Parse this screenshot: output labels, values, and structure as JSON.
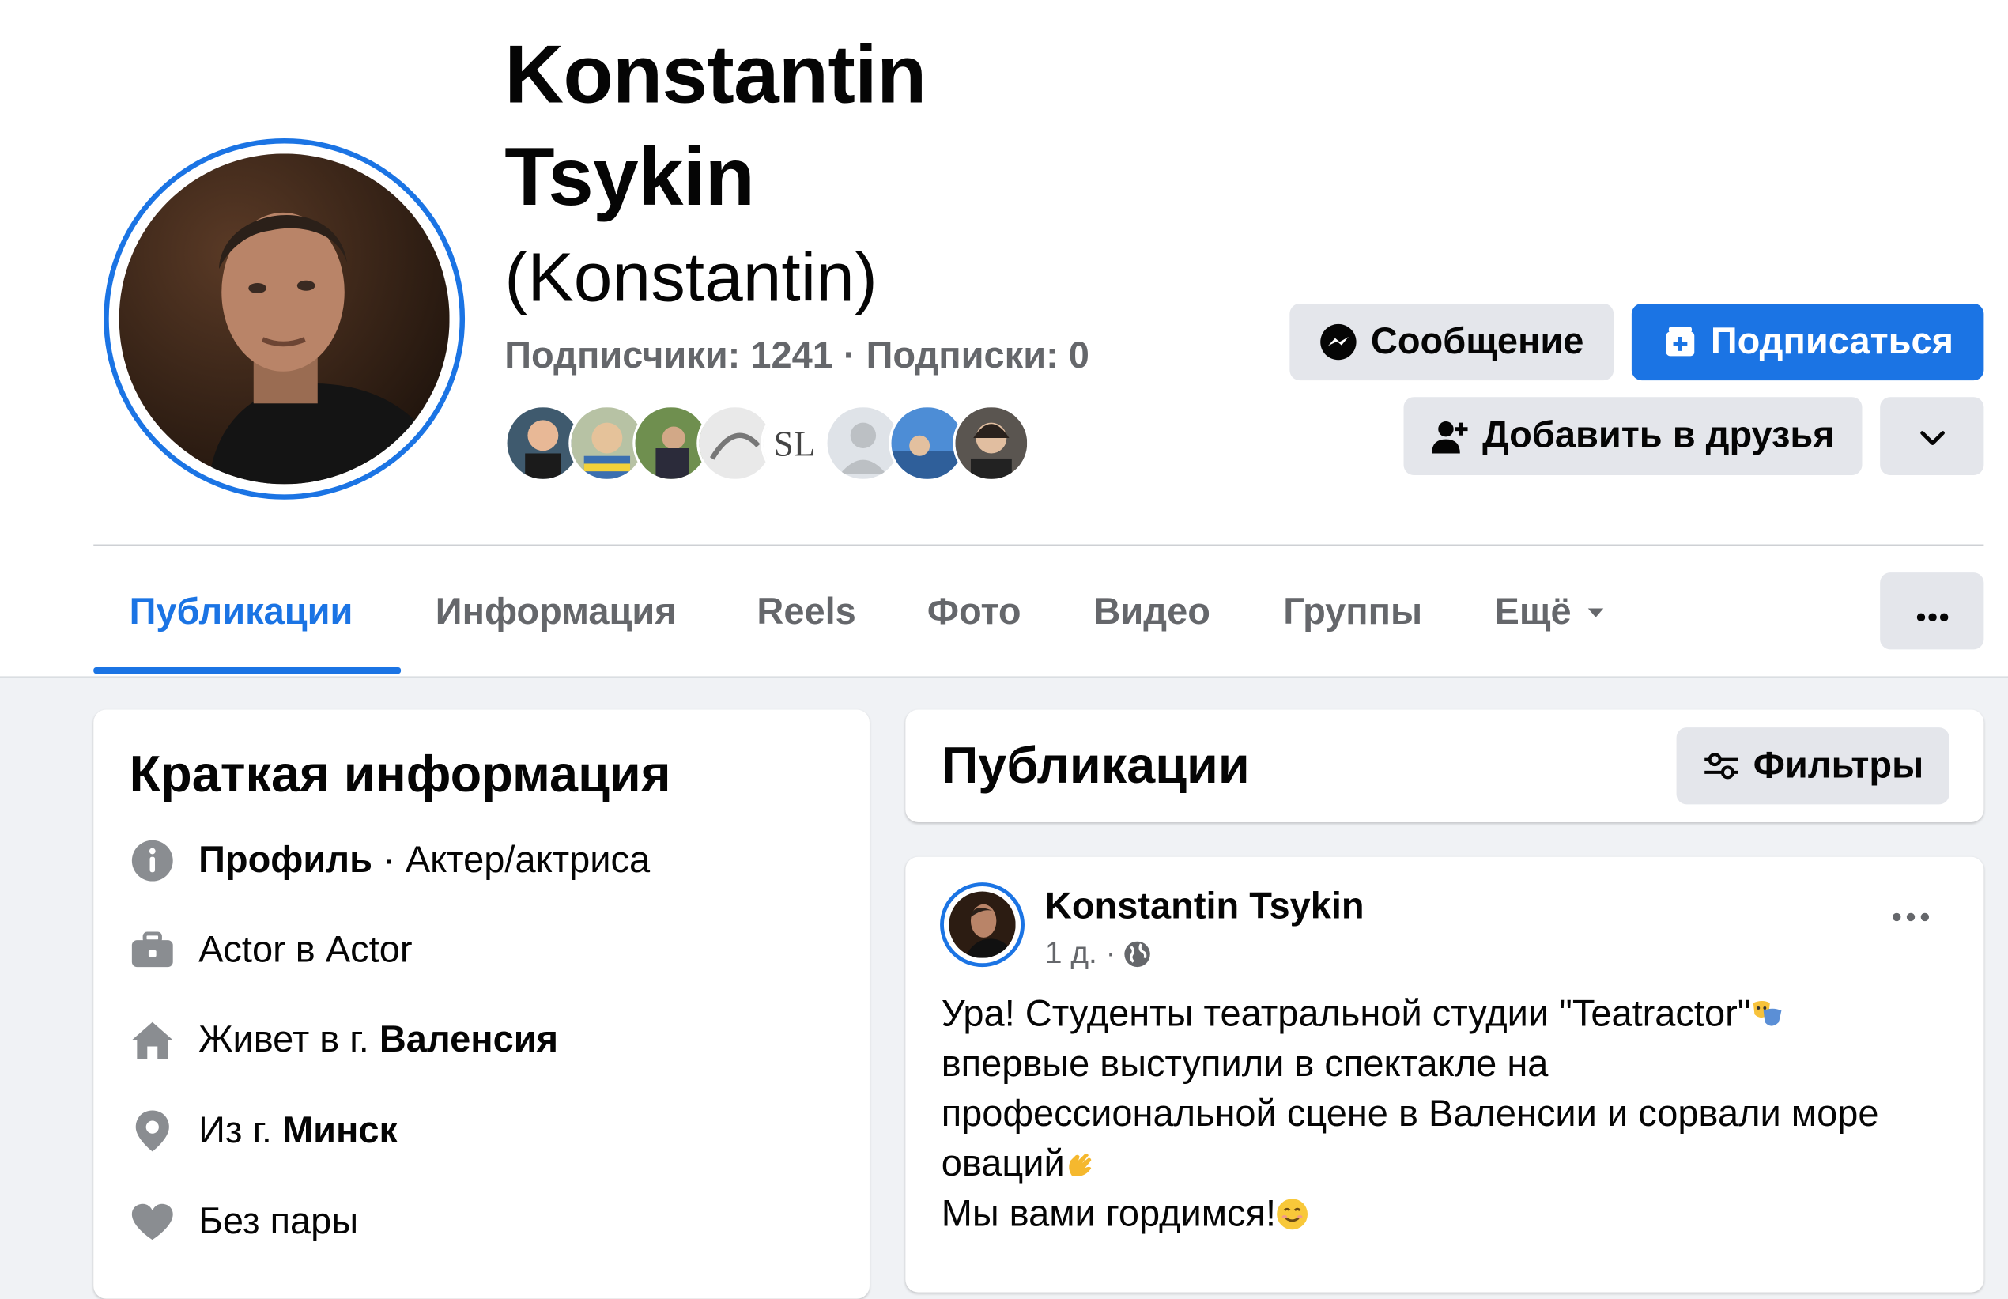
{
  "profile": {
    "name_line1": "Konstantin",
    "name_line2": "Tsykin",
    "nickname": "(Konstantin)",
    "followers_text": "Подписчики: 1241 · Подписки: 0",
    "friend_avatars_count": 8,
    "accent_color": "#1b74e4"
  },
  "actions": {
    "message": "Сообщение",
    "subscribe": "Подписаться",
    "add_friend": "Добавить в друзья"
  },
  "tabs": [
    {
      "label": "Публикации",
      "active": true
    },
    {
      "label": "Информация",
      "active": false
    },
    {
      "label": "Reels",
      "active": false
    },
    {
      "label": "Фото",
      "active": false
    },
    {
      "label": "Видео",
      "active": false
    },
    {
      "label": "Группы",
      "active": false
    },
    {
      "label": "Ещё",
      "active": false
    }
  ],
  "intro": {
    "title": "Краткая информация",
    "profile_label": "Профиль",
    "profile_value": " · Актер/актриса",
    "work": "Actor в Actor",
    "lives_prefix": "Живет в г. ",
    "lives_city": "Валенсия",
    "from_prefix": "Из г. ",
    "from_city": "Минск",
    "relationship": "Без пары"
  },
  "posts_header": {
    "title": "Публикации",
    "filters": "Фильтры"
  },
  "post": {
    "author": "Konstantin Tsykin",
    "time": "1 д. ·",
    "line1": "Ура! Студенты театральной студии \"Teatractor\"",
    "line2": "впервые выступили в спектакле на",
    "line3": "профессиональной сцене в Валенсии и сорвали море",
    "line4": "оваций",
    "line5": "Мы вами гордимся!"
  }
}
